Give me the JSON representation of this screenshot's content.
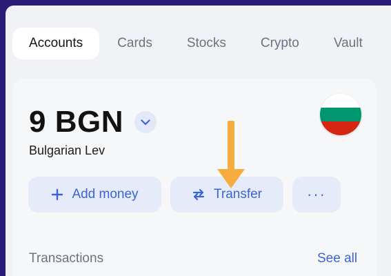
{
  "tabs": [
    {
      "label": "Accounts",
      "active": true
    },
    {
      "label": "Cards",
      "active": false
    },
    {
      "label": "Stocks",
      "active": false
    },
    {
      "label": "Crypto",
      "active": false
    },
    {
      "label": "Vault",
      "active": false
    }
  ],
  "account": {
    "balance": "9 BGN",
    "currency_name": "Bulgarian Lev",
    "flag_colors": [
      "#ffffff",
      "#00966e",
      "#d62612"
    ]
  },
  "actions": {
    "add_money": "Add money",
    "transfer": "Transfer",
    "more": "···"
  },
  "transactions": {
    "label": "Transactions",
    "see_all": "See all"
  },
  "colors": {
    "frame": "#2d1b7a",
    "accent": "#3b63d8",
    "button_bg": "#e5ebf9",
    "annotation_arrow": "#f6ad3f"
  },
  "icons": [
    "chevron-down-icon",
    "plus-icon",
    "transfer-arrows-icon",
    "more-dots-icon",
    "annotation-arrow-icon"
  ]
}
